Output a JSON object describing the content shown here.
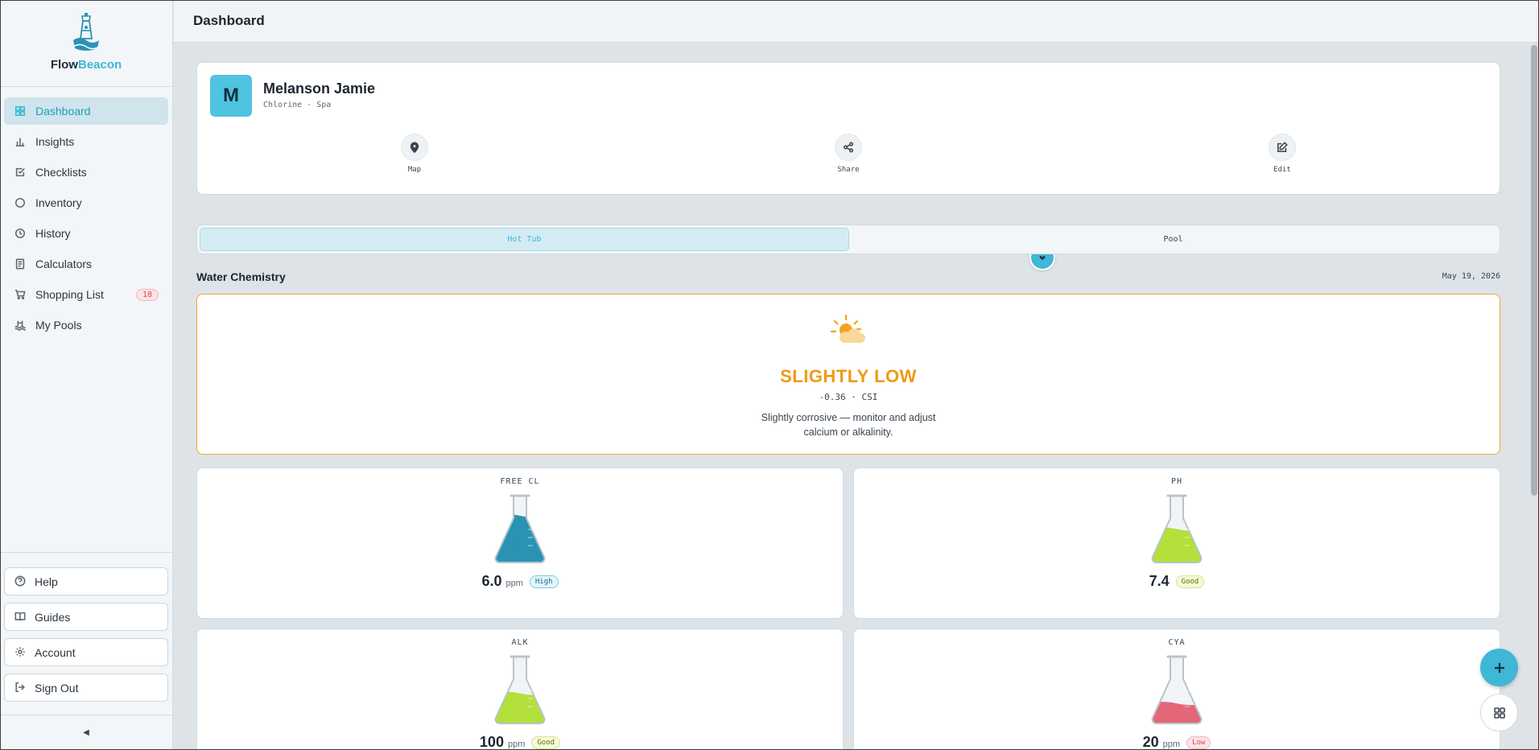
{
  "app": {
    "name_part1": "Flow",
    "name_part2": "Beacon",
    "logo_icon": "lighthouse-icon"
  },
  "sidebar": {
    "items": [
      {
        "label": "Dashboard",
        "icon": "grid-icon",
        "active": true
      },
      {
        "label": "Insights",
        "icon": "bar-chart-icon"
      },
      {
        "label": "Checklists",
        "icon": "checkbox-icon"
      },
      {
        "label": "Inventory",
        "icon": "circle-icon"
      },
      {
        "label": "History",
        "icon": "clock-icon"
      },
      {
        "label": "Calculators",
        "icon": "calculator-icon"
      },
      {
        "label": "Shopping List",
        "icon": "cart-icon",
        "badge": "18"
      },
      {
        "label": "My Pools",
        "icon": "pool-ladder-icon"
      }
    ],
    "bottom": [
      {
        "label": "Help",
        "icon": "help-circle-icon"
      },
      {
        "label": "Guides",
        "icon": "book-icon"
      },
      {
        "label": "Account",
        "icon": "gear-icon"
      },
      {
        "label": "Sign Out",
        "icon": "logout-icon"
      }
    ],
    "collapse_glyph": "◀"
  },
  "header": {
    "title": "Dashboard"
  },
  "profile": {
    "initial": "M",
    "name": "Melanson Jamie",
    "subtitle": "Chlorine · Spa",
    "actions": [
      {
        "label": "Map",
        "icon": "map-pin-icon"
      },
      {
        "label": "Share",
        "icon": "share-icon"
      },
      {
        "label": "Edit",
        "icon": "edit-icon"
      }
    ]
  },
  "tabs": [
    {
      "label": "Hot Tub",
      "active": true
    },
    {
      "label": "Pool",
      "active": false
    }
  ],
  "water_chemistry": {
    "title": "Water Chemistry",
    "date": "May 19, 2026",
    "csi": {
      "icon": "sun-cloud-icon",
      "status": "SLIGHTLY LOW",
      "value_text": "-0.36 · CSI",
      "description": "Slightly corrosive — monitor and adjust calcium or alkalinity."
    },
    "metrics": [
      {
        "label": "FREE CL",
        "value": "6.0",
        "unit": "ppm",
        "status": "High",
        "status_kind": "high",
        "fill_color": "#2a93b4",
        "fill_level": 0.7
      },
      {
        "label": "PH",
        "value": "7.4",
        "unit": "",
        "status": "Good",
        "status_kind": "good",
        "fill_color": "#b3e03a",
        "fill_level": 0.5
      },
      {
        "label": "ALK",
        "value": "100",
        "unit": "ppm",
        "status": "Good",
        "status_kind": "good",
        "fill_color": "#b3e03a",
        "fill_level": 0.45
      },
      {
        "label": "CYA",
        "value": "20",
        "unit": "ppm",
        "status": "Low",
        "status_kind": "low",
        "fill_color": "#e46679",
        "fill_level": 0.3
      }
    ]
  },
  "colors": {
    "accent": "#3fb7d6",
    "warning": "#ee9a12"
  }
}
